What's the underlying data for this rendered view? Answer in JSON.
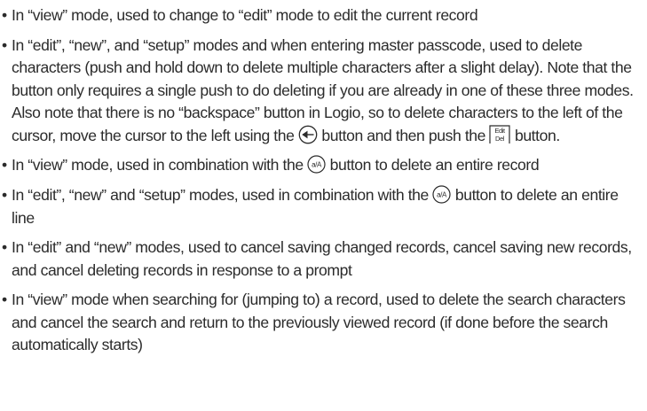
{
  "bullet_glyph": "•",
  "items": [
    {
      "text": "In “view” mode, used to change to “edit” mode to edit the current record"
    },
    {
      "text_a": "In “edit”, “new”, and “setup” modes and when entering master passcode, used to delete characters (push and hold down to delete multiple characters after a slight delay). Note that the button only requires a single push to do deleting if you are already in one of these three modes. Also note that there is no “backspace” button in Logio, so to delete characters to the left of the cursor, move the cursor to the left using the ",
      "text_b": " button and then push the ",
      "text_c": " button."
    },
    {
      "text_a": "In “view” mode, used in combination with the ",
      "text_b": " button to delete an entire record"
    },
    {
      "text_a": "In “edit”, “new” and “setup” modes, used in combination with the ",
      "text_b": " button to delete an entire line"
    },
    {
      "text": "In “edit” and “new” modes, used to cancel saving changed records, cancel saving new records, and cancel deleting records in response to a prompt"
    },
    {
      "text": "In “view” mode when searching for (jumping to) a record, used to delete the search characters and cancel the search and return to the previously viewed record (if done before the search automatically starts)"
    }
  ],
  "icons": {
    "left_arrow": "left-arrow-button-icon",
    "edit_del": {
      "name": "edit-del-button-icon",
      "line1": "Edit",
      "line2": "Del"
    },
    "case": {
      "name": "case-toggle-button-icon",
      "label": "a/A"
    }
  }
}
